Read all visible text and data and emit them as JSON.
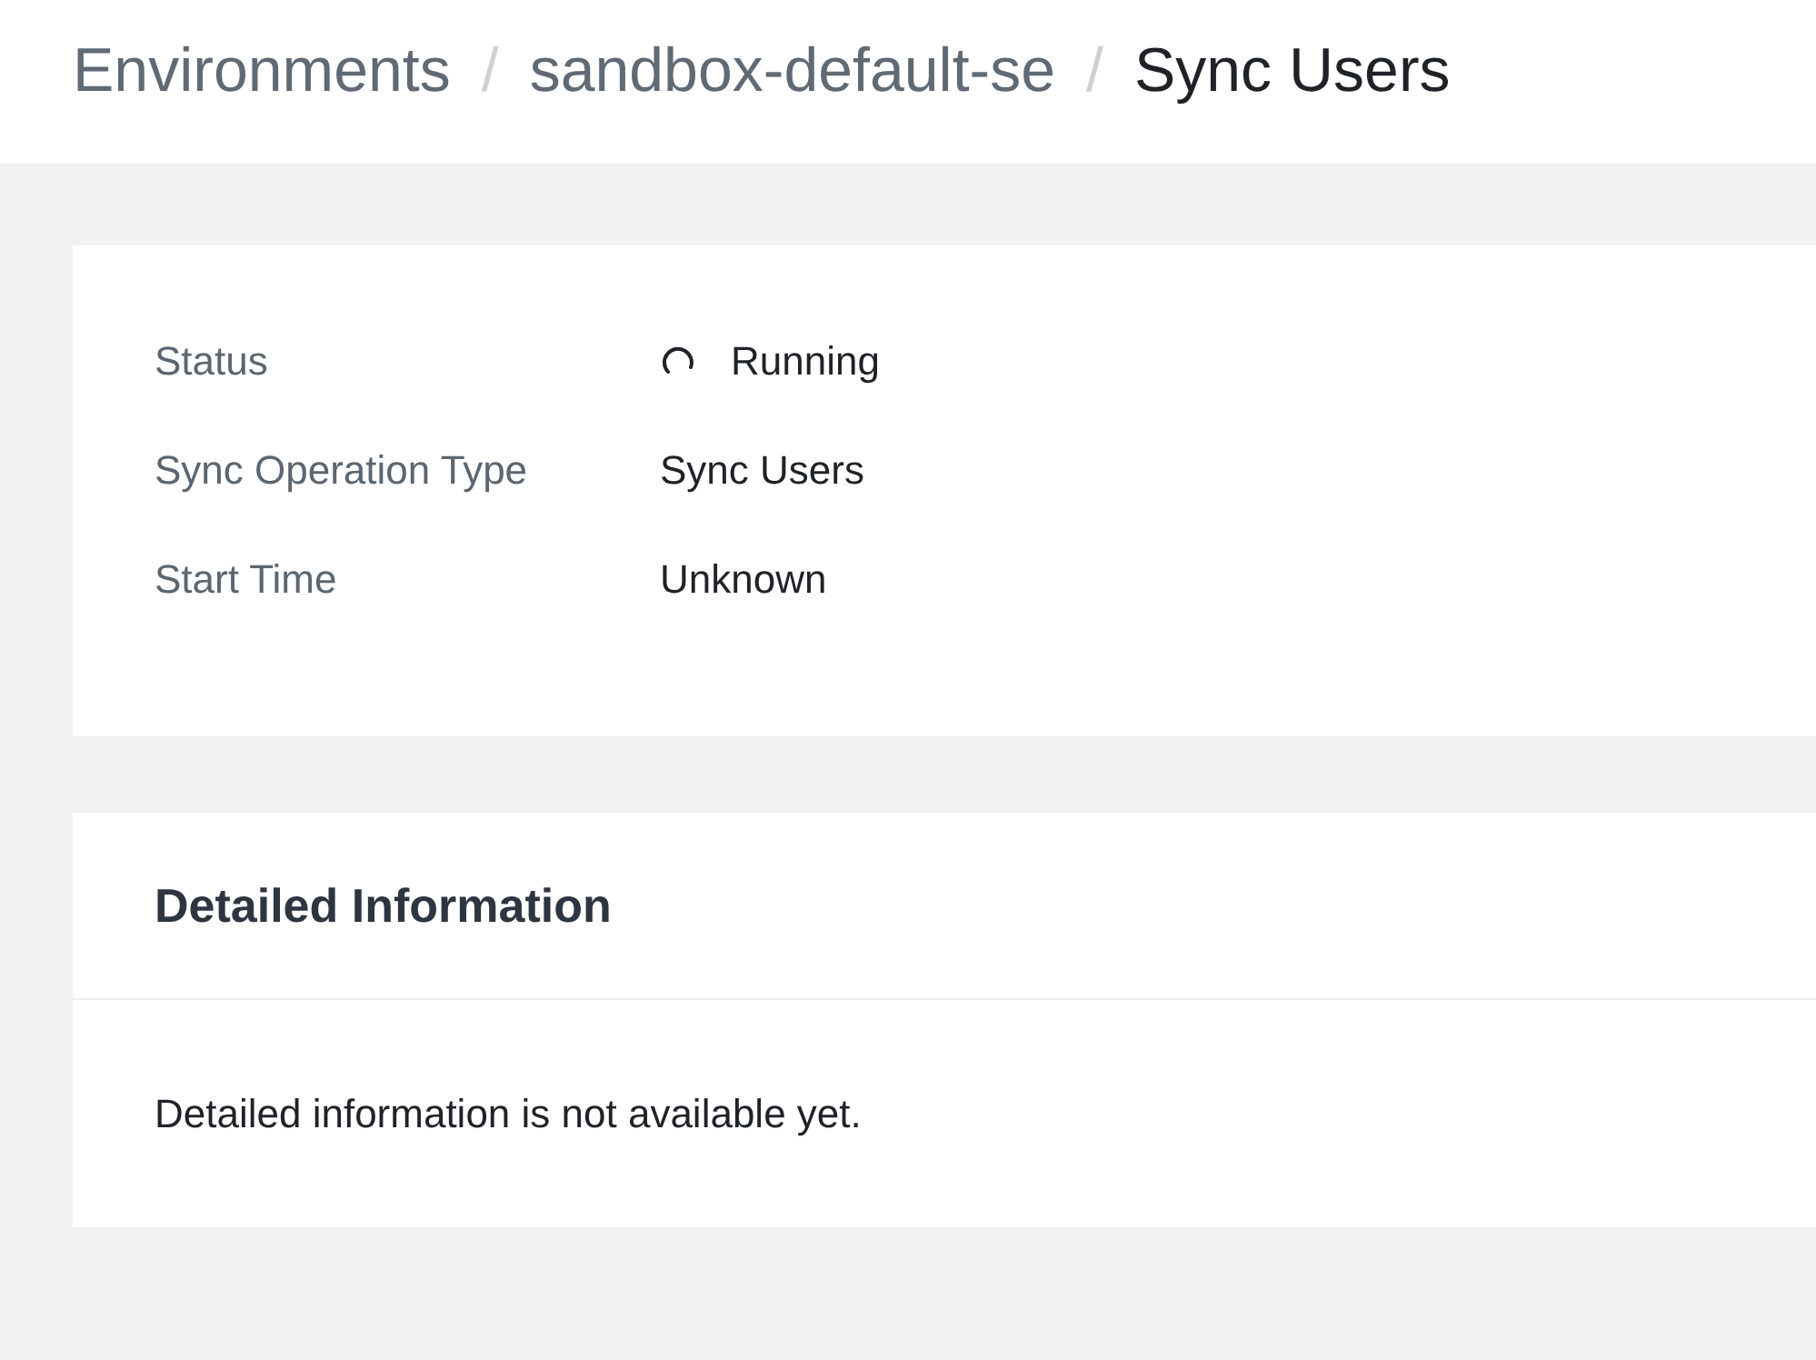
{
  "breadcrumb": {
    "items": [
      {
        "label": "Environments",
        "kind": "link"
      },
      {
        "label": "sandbox-default-se",
        "kind": "link"
      },
      {
        "label": "Sync Users",
        "kind": "current"
      }
    ],
    "separators": [
      "/",
      "/"
    ]
  },
  "summary": [
    {
      "label": "Status",
      "value": "Running",
      "kind": "status"
    },
    {
      "label": "Sync Operation Type",
      "value": "Sync Users",
      "kind": "text"
    },
    {
      "label": "Start Time",
      "value": "Unknown",
      "kind": "text"
    }
  ],
  "detailed_information": {
    "title": "Detailed Information",
    "message": "Detailed information is not available yet."
  }
}
